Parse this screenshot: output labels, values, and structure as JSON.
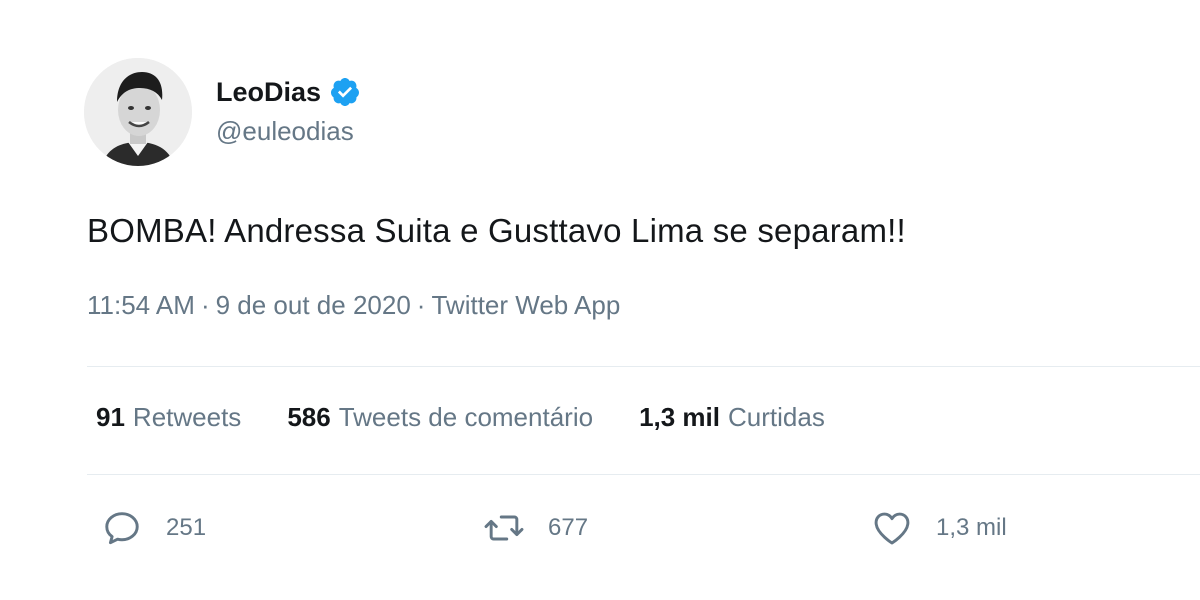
{
  "user": {
    "display_name": "LeoDias",
    "handle": "@euleodias",
    "verified": true
  },
  "tweet": {
    "text": "BOMBA! Andressa Suita e Gusttavo Lima se separam!!",
    "time": "11:54 AM",
    "separator": "·",
    "date": "9 de out de 2020",
    "source": "Twitter Web App"
  },
  "stats": {
    "retweets_count": "91",
    "retweets_label": "Retweets",
    "quotes_count": "586",
    "quotes_label": "Tweets de comentário",
    "likes_count": "1,3 mil",
    "likes_label": "Curtidas"
  },
  "actions": {
    "reply_count": "251",
    "retweet_count": "677",
    "like_count": "1,3 mil",
    "reply_icon": "reply-icon",
    "retweet_icon": "retweet-icon",
    "like_icon": "heart-icon"
  },
  "colors": {
    "text": "#14171a",
    "secondary": "#657786",
    "verified": "#1da1f2",
    "divider": "#e6ecf0"
  }
}
